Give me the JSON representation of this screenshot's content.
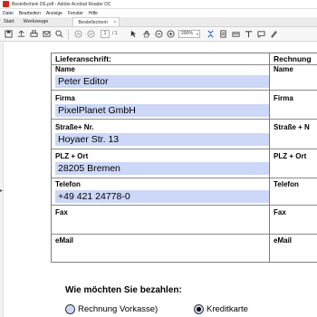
{
  "window": {
    "title": "Bestellschein DE.pdf - Adobe Acrobat Reader DC"
  },
  "menu": [
    "Datei",
    "Bearbeiten",
    "Anzeige",
    "Fenster",
    "Hilfe"
  ],
  "tabs": {
    "home": "Start",
    "tools": "Werkzeuge",
    "document": "Bestellschein DE.pdf",
    "close_glyph": "×"
  },
  "toolbar": {
    "page_current": "1",
    "page_total": "/ 1",
    "zoom": "200%",
    "zoom_arrow": "▾"
  },
  "form": {
    "left_header": "Lieferanschrift:",
    "right_header": "Rechnung",
    "fields": [
      {
        "label": "Name",
        "value": "Peter Editor"
      },
      {
        "label": "Firma",
        "value": "PixelPlanet GmbH"
      },
      {
        "label": "Straße+ Nr.",
        "value": "Hoyaer Str. 13"
      },
      {
        "label": "PLZ + Ort",
        "value": "28205 Bremen"
      },
      {
        "label": "Telefon",
        "value": "+49 421 24778-0"
      },
      {
        "label": "Fax",
        "value": ""
      },
      {
        "label": "eMail",
        "value": ""
      }
    ],
    "right_labels": [
      "Name",
      "Firma",
      "Straße + N",
      "PLZ + Ort",
      "Telefon",
      "Fax",
      "eMail"
    ]
  },
  "payment": {
    "question": "Wie möchten Sie bezahlen:",
    "options": [
      {
        "label": "Rechnung Vorkasse)",
        "checked": false
      },
      {
        "label": "Kreditkarte",
        "checked": true
      }
    ]
  },
  "colors": {
    "field_fill": "#cdd8f8",
    "acrobat_red": "#d4271b"
  }
}
